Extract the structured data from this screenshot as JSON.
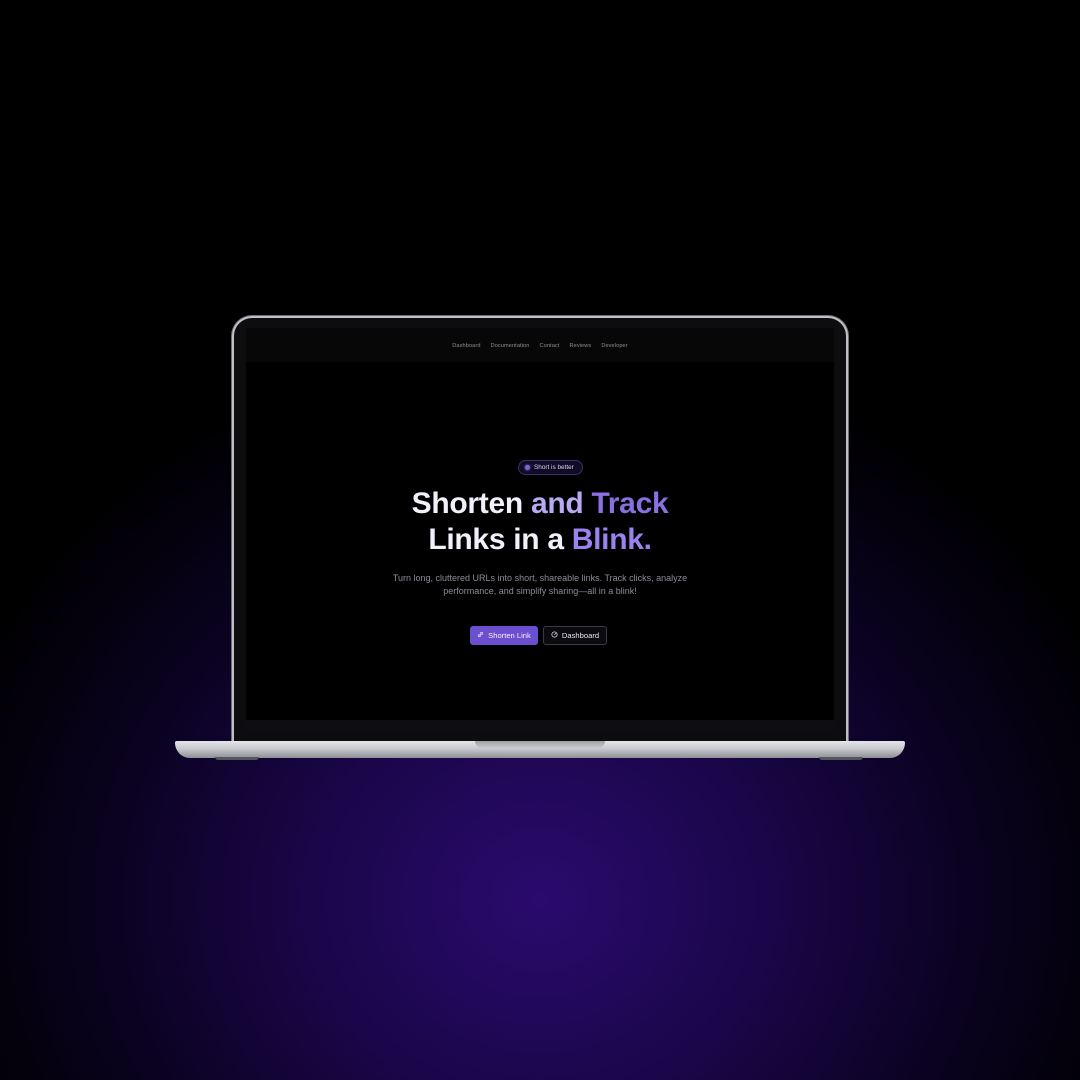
{
  "nav": {
    "items": [
      {
        "label": "Dashboard"
      },
      {
        "label": "Documentation"
      },
      {
        "label": "Contact"
      },
      {
        "label": "Reviews"
      },
      {
        "label": "Developer"
      }
    ]
  },
  "hero": {
    "badge": "Short is better",
    "headline": {
      "part1": "Shorten",
      "part2": "and",
      "part3": "Track",
      "part4": "Links in a",
      "part5": "Blink."
    },
    "description": "Turn long, cluttered URLs into short, shareable links. Track clicks, analyze performance, and simplify sharing—all in a blink!",
    "primary_button": {
      "label": "Shorten Link",
      "icon": "link-icon"
    },
    "secondary_button": {
      "label": "Dashboard",
      "icon": "dashboard-icon"
    }
  },
  "colors": {
    "accent": "#6b4fce",
    "headline_gradient_end": "#8a70e0",
    "background_glow": "#2a0a6e"
  }
}
